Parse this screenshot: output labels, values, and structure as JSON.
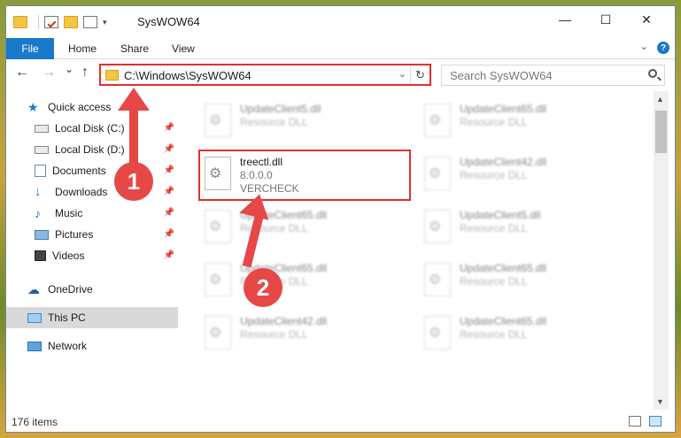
{
  "window": {
    "title": "SysWOW64",
    "minimize": "—",
    "maximize": "☐",
    "close": "✕"
  },
  "ribbon": {
    "tabs": [
      {
        "label": "File"
      },
      {
        "label": "Home"
      },
      {
        "label": "Share"
      },
      {
        "label": "View"
      }
    ],
    "help": "?"
  },
  "nav": {
    "back": "←",
    "forward": "→",
    "recent": "⌄",
    "up": "↑",
    "address": "C:\\Windows\\SysWOW64",
    "refresh": "↻",
    "search_placeholder": "Search SysWOW64"
  },
  "sidebar": {
    "items": [
      {
        "label": "Quick access",
        "icon": "star-icon"
      },
      {
        "label": "Local Disk (C:)",
        "icon": "drive-icon",
        "pinned": true
      },
      {
        "label": "Local Disk (D:)",
        "icon": "drive-icon",
        "pinned": true
      },
      {
        "label": "Documents",
        "icon": "documents-icon",
        "pinned": true
      },
      {
        "label": "Downloads",
        "icon": "downloads-icon",
        "pinned": true
      },
      {
        "label": "Music",
        "icon": "music-icon",
        "pinned": true
      },
      {
        "label": "Pictures",
        "icon": "pictures-icon",
        "pinned": true
      },
      {
        "label": "Videos",
        "icon": "videos-icon",
        "pinned": true
      },
      {
        "label": "OneDrive",
        "icon": "cloud-icon"
      },
      {
        "label": "This PC",
        "icon": "computer-icon",
        "selected": true
      },
      {
        "label": "Network",
        "icon": "network-icon"
      }
    ],
    "pin": "📌"
  },
  "files": {
    "left": [
      {
        "name": "UpdateClient5.dll",
        "type": "Resource DLL"
      },
      {
        "name": "treectl.dll",
        "version": "8.0.0.0",
        "company": "VERCHECK"
      },
      {
        "name": "UpdateClient65.dll",
        "type": "Resource DLL"
      },
      {
        "name": "UpdateClient65.dll",
        "type": "Resource DLL"
      },
      {
        "name": "UpdateClient42.dll",
        "type": "Resource DLL"
      }
    ],
    "right": [
      {
        "name": "UpdateClient65.dll",
        "type": "Resource DLL"
      },
      {
        "name": "UpdateClient42.dll",
        "type": "Resource DLL"
      },
      {
        "name": "UpdateClient5.dll",
        "type": "Resource DLL"
      },
      {
        "name": "UpdateClient65.dll",
        "type": "Resource DLL"
      },
      {
        "name": "UpdateClient65.dll",
        "type": "Resource DLL"
      }
    ]
  },
  "status": {
    "count": "176 items"
  },
  "callouts": {
    "one": "1",
    "two": "2"
  },
  "colors": {
    "accent": "#1979ca",
    "highlight": "#e03030",
    "callout": "#e64848",
    "selected": "#d9d9d9"
  }
}
